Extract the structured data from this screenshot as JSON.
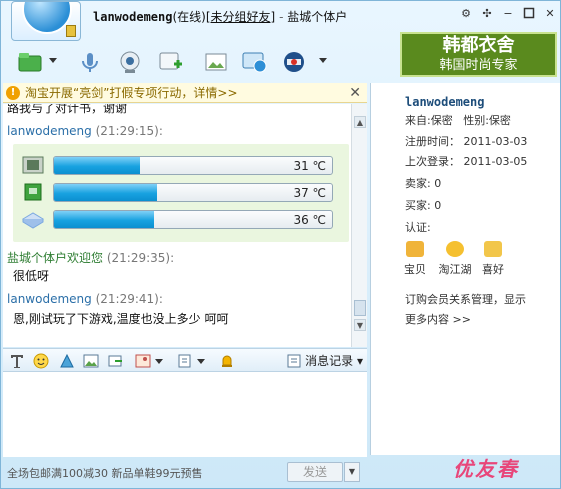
{
  "title": {
    "nick": "lanwodemeng",
    "status": "(在线)",
    "group": "[未分组好友]",
    "separator": "-",
    "shop": "盐城个体户"
  },
  "window_buttons": {
    "settings": "⚙",
    "pin": "✣",
    "minimize": "−",
    "close": "✕"
  },
  "ad": {
    "line1": "韩都衣舍",
    "line2": "韩国时尚专家"
  },
  "notice": {
    "icon": "!",
    "text": "淘宝开展“亮剑”打假专项行动，详情>>",
    "close": "✕"
  },
  "chat": {
    "cut_line": "路我与了对计书，谢谢",
    "msg1": {
      "name": "lanwodemeng",
      "time": "(21:29:15):"
    },
    "hardware": [
      {
        "icon": "cpu-icon",
        "value": "31 ℃",
        "level": 0.31,
        "color": "#5b7a5b"
      },
      {
        "icon": "gpu-icon",
        "value": "37 ℃",
        "level": 0.37,
        "color": "#2e8b2e"
      },
      {
        "icon": "disk-icon",
        "value": "36 ℃",
        "level": 0.36,
        "color": "#7aa8e0"
      }
    ],
    "msg2": {
      "name": "盐城个体户欢迎您",
      "time": "(21:29:35):",
      "text": "很低呀"
    },
    "msg3": {
      "name": "lanwodemeng",
      "time": "(21:29:41):",
      "text": "恩,刚试玩了下游戏,温度也没上多少 呵呵"
    }
  },
  "format_bar": {
    "record_label": "消息记录"
  },
  "bottom": {
    "promo": "全场包邮满100减30  新品单鞋99元预售",
    "send": "发送",
    "send_menu": "▼"
  },
  "profile": {
    "name": "lanwodemeng",
    "from": "来自:保密",
    "gender": "性别:保密",
    "register": "注册时间： 2011-03-03",
    "last_login": "上次登录： 2011-03-05",
    "seller": "卖家: 0",
    "buyer": "买家: 0",
    "verify": "认证:",
    "icons": [
      {
        "name": "baobei-icon",
        "label": "宝贝"
      },
      {
        "name": "taojianghu-icon",
        "label": "淘江湖"
      },
      {
        "name": "xihao-icon",
        "label": "喜好"
      }
    ],
    "link_line1": "订购会员关系管理，显示",
    "link_line2": "更多内容 >>"
  },
  "brand": "优友春"
}
